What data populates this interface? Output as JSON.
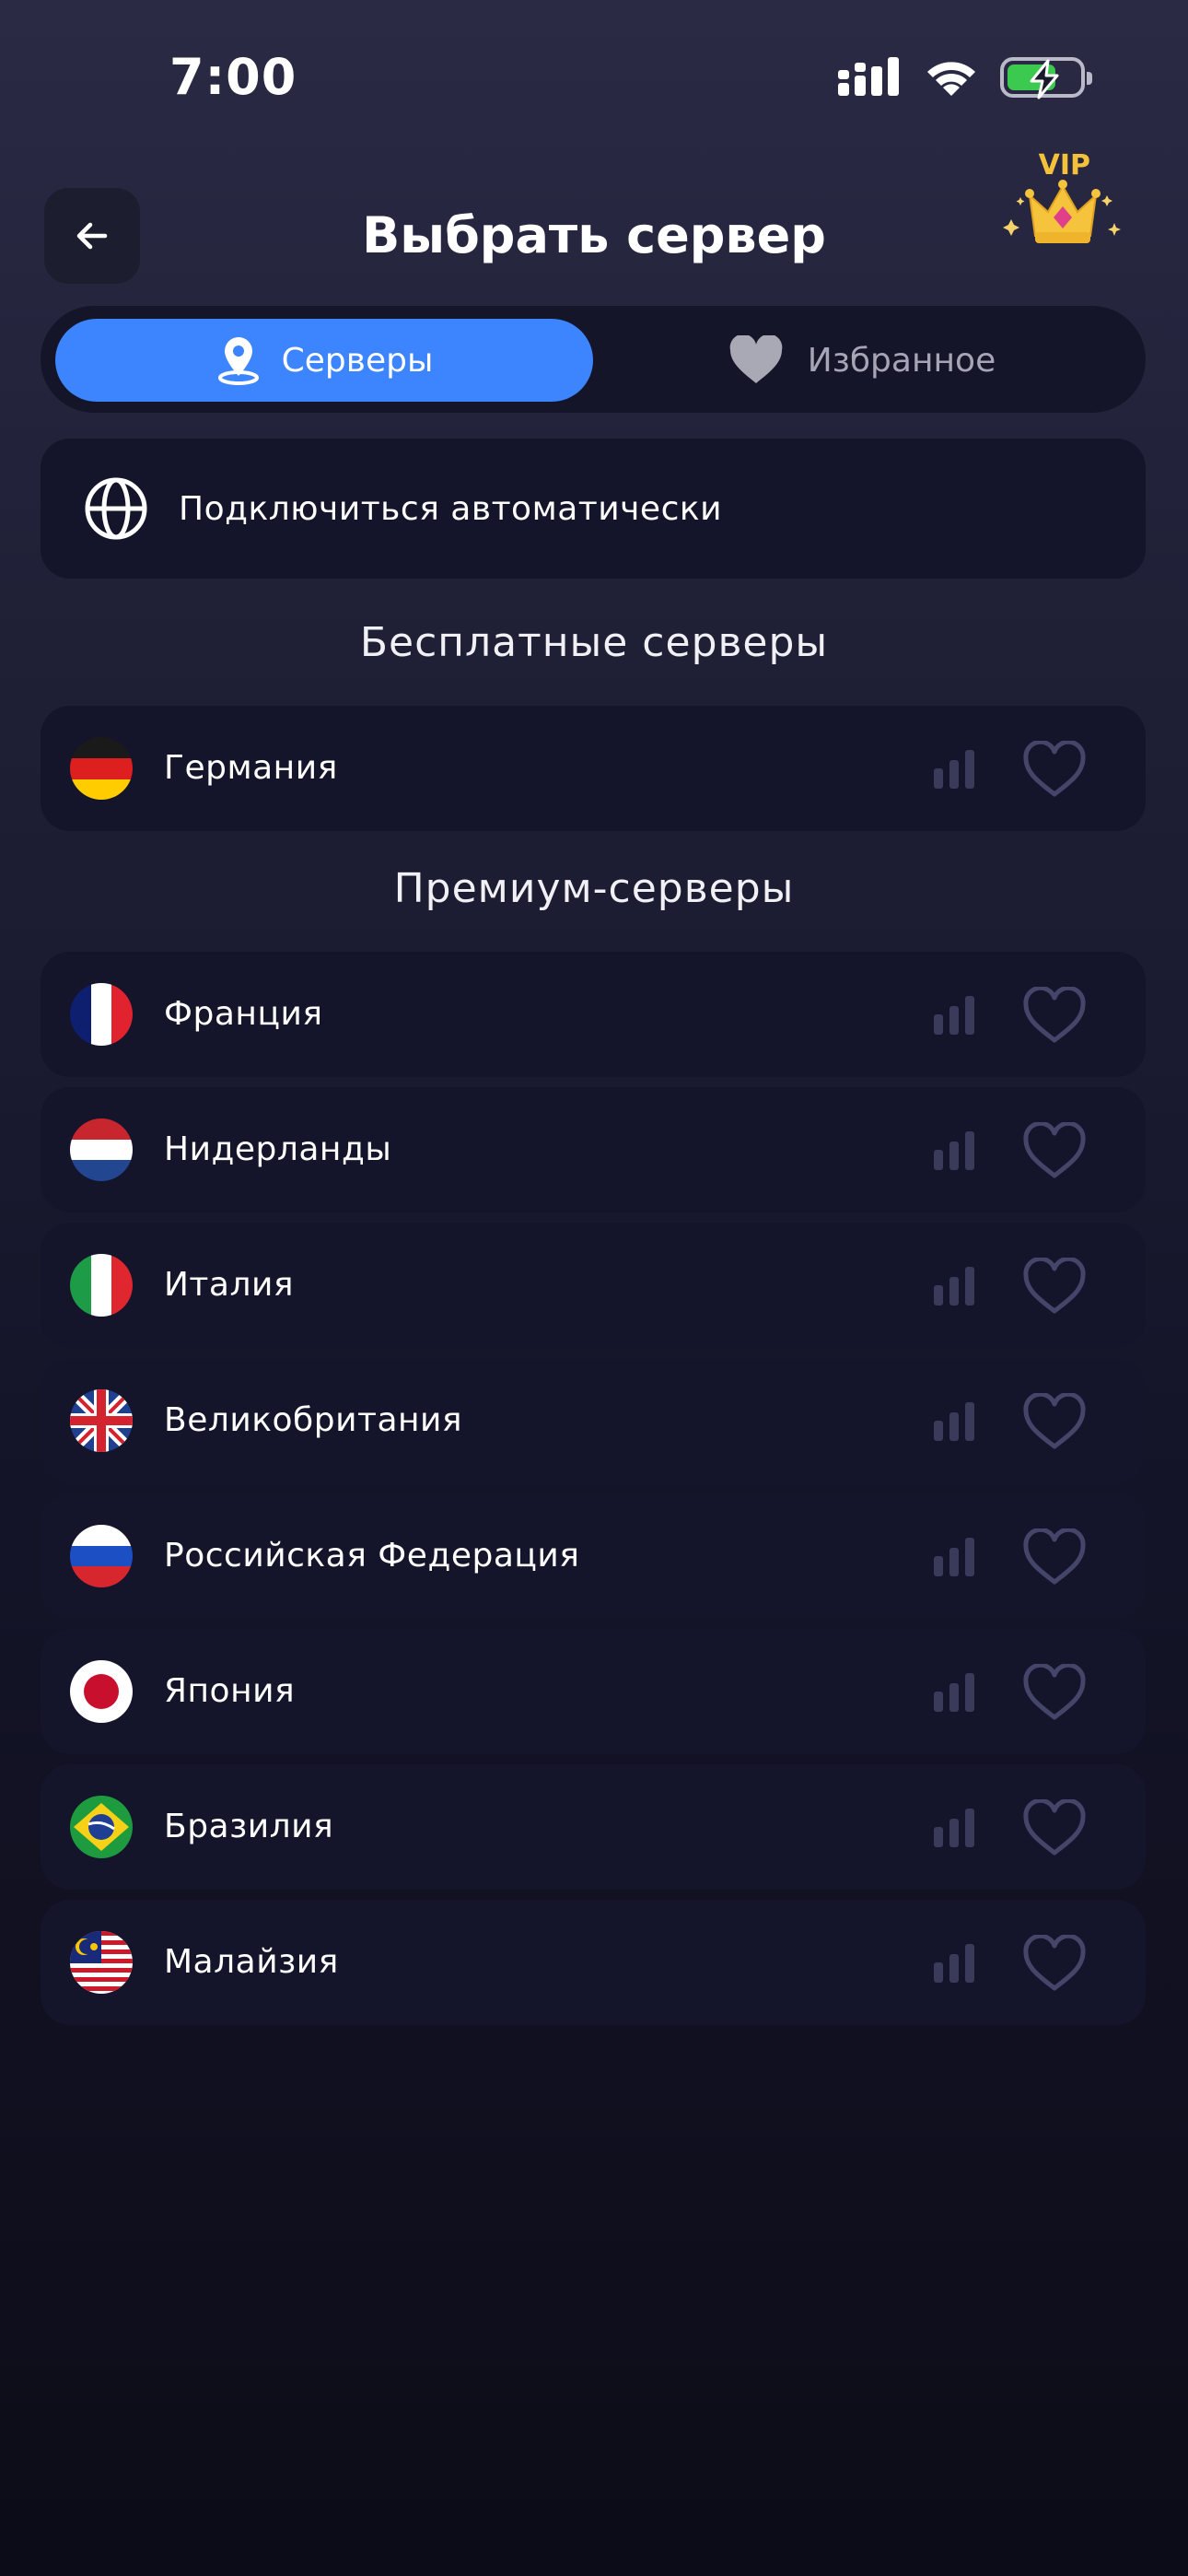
{
  "status_bar": {
    "time": "7:00"
  },
  "header": {
    "title": "Выбрать сервер",
    "vip_label": "VIP"
  },
  "tabs": {
    "servers": "Серверы",
    "favorites": "Избранное"
  },
  "auto_connect": {
    "label": "Подключиться автоматически"
  },
  "sections": {
    "free": "Бесплатные серверы",
    "premium": "Премиум-серверы"
  },
  "free_servers": [
    {
      "name": "Германия"
    }
  ],
  "premium_servers": [
    {
      "name": "Франция"
    },
    {
      "name": "Нидерланды"
    },
    {
      "name": "Италия"
    },
    {
      "name": "Великобритания"
    },
    {
      "name": "Российская Федерация"
    },
    {
      "name": "Япония"
    },
    {
      "name": "Бразилия"
    },
    {
      "name": "Малайзия"
    }
  ],
  "colors": {
    "accent": "#3d84ff",
    "row_bg": "#14142a",
    "vip_gold": "#f4c13a",
    "battery_green": "#3cc94f"
  }
}
